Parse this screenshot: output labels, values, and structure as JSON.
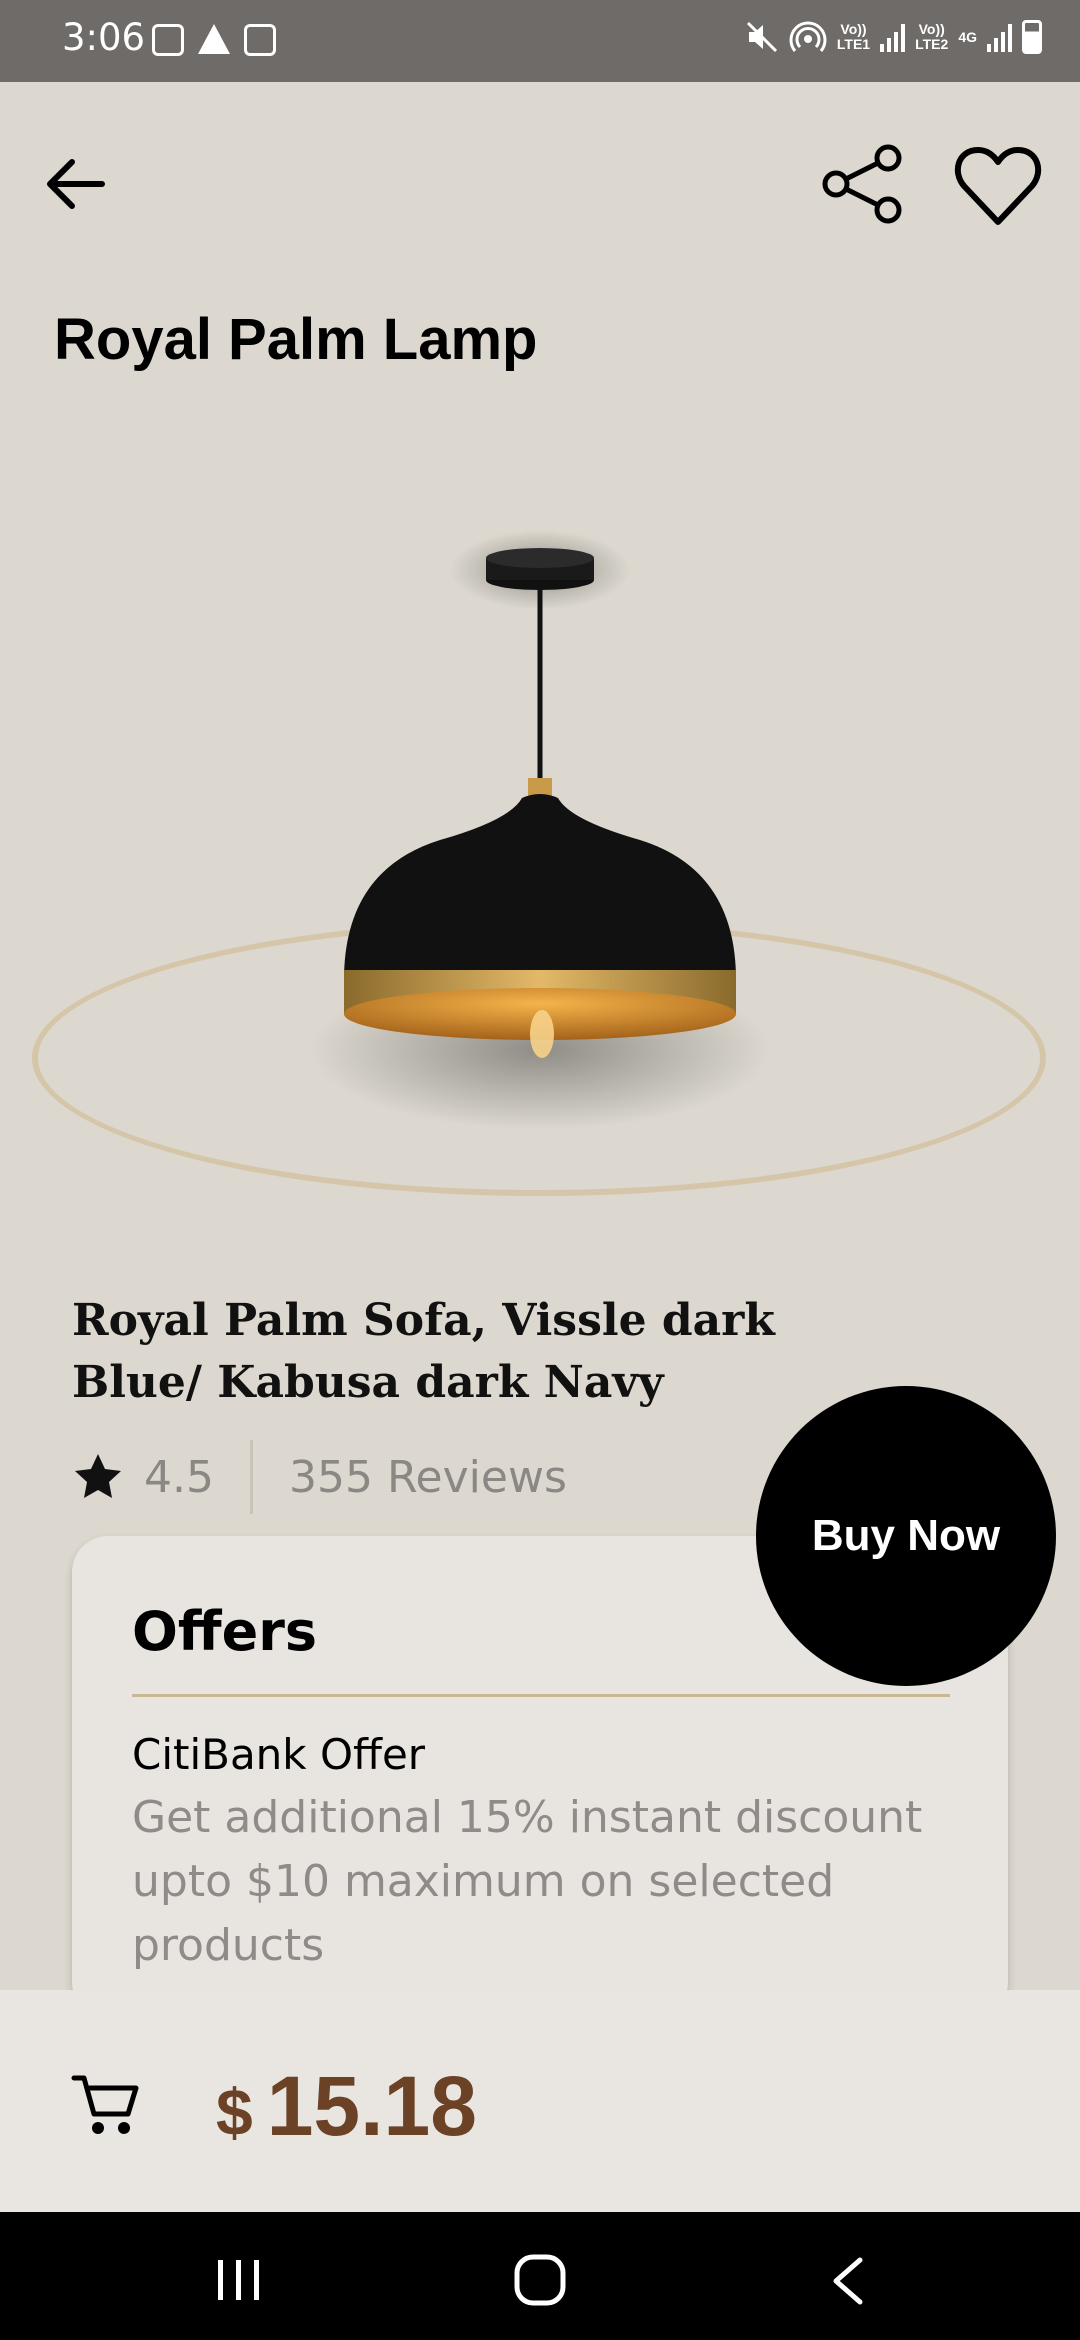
{
  "status_bar": {
    "time": "3:06",
    "sim1_label": "Vo))\nLTE1",
    "sim2_label": "Vo))\nLTE2",
    "network": "4G"
  },
  "header": {
    "back_icon": "arrow-left-icon",
    "share_icon": "share-icon",
    "favorite_icon": "heart-outline-icon"
  },
  "page_title": "Royal Palm Lamp",
  "product": {
    "image_alt": "pendant-lamp",
    "name": "Royal Palm Sofa, Vissle dark Blue/ Kabusa dark Navy",
    "rating": "4.5",
    "reviews": "355 Reviews"
  },
  "offers": {
    "title": "Offers",
    "items": [
      {
        "name": "CitiBank Offer",
        "description": "Get additional 15% instant discount upto $10 maximum on selected products"
      }
    ]
  },
  "buy_now_label": "Buy Now",
  "bottom_bar": {
    "cart_icon": "cart-icon",
    "currency": "$",
    "price": "15.18"
  },
  "colors": {
    "background": "#dcd8cf",
    "price": "#6b4226",
    "accent_ring": "#d4c3a2",
    "card": "#e8e5e0"
  }
}
